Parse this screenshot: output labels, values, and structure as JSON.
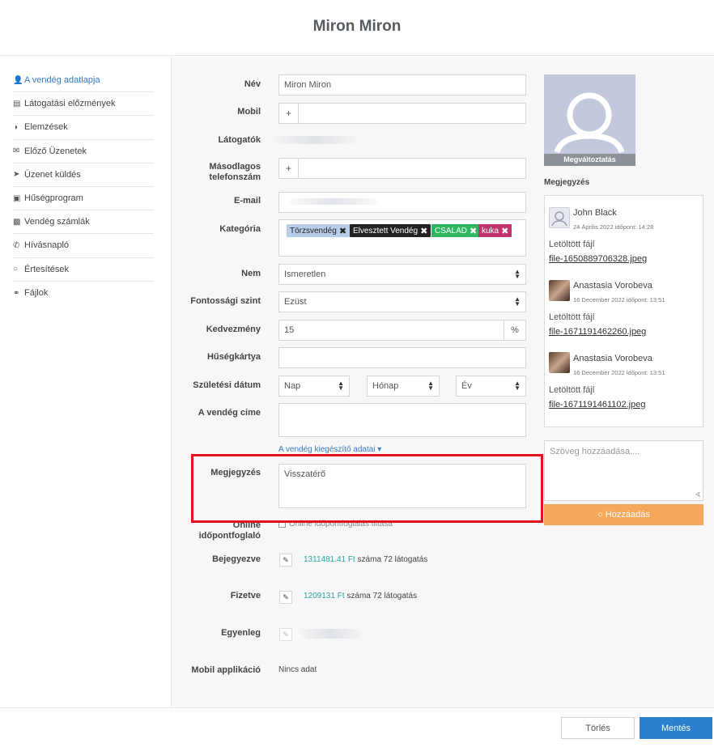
{
  "header": {
    "title": "Miron Miron"
  },
  "sidebar": {
    "items": [
      {
        "label": "A vendég adatlapja",
        "icon": "user-icon"
      },
      {
        "label": "Látogatási előzmények",
        "icon": "list-icon"
      },
      {
        "label": "Elemzések",
        "icon": "pie-chart-icon"
      },
      {
        "label": "Előző Üzenetek",
        "icon": "envelope-icon"
      },
      {
        "label": "Üzenet küldés",
        "icon": "paper-plane-icon"
      },
      {
        "label": "Hűségprogram",
        "icon": "card-icon"
      },
      {
        "label": "Vendég számlák",
        "icon": "briefcase-icon"
      },
      {
        "label": "Hívásnapló",
        "icon": "phone-icon"
      },
      {
        "label": "Értesítések",
        "icon": "comment-icon"
      },
      {
        "label": "Fájlok",
        "icon": "paperclip-icon"
      }
    ]
  },
  "form": {
    "name_label": "Név",
    "name_value": "Miron Miron",
    "mobile_label": "Mobil",
    "mobile_prefix": "+",
    "visitors_label": "Látogatók",
    "secondary_phone_label_1": "Másodlagos",
    "secondary_phone_label_2": "telefonszám",
    "secondary_prefix": "+",
    "email_label": "E-mail",
    "category_label": "Kategória",
    "tags": [
      {
        "label": "Törzsvendég",
        "bg": "#b7cdea",
        "fg": "#222222"
      },
      {
        "label": "Elvesztett Vendég",
        "bg": "#222222",
        "fg": "#ffffff"
      },
      {
        "label": "CSALAD",
        "bg": "#2db560",
        "fg": "#ffffff"
      },
      {
        "label": "kuka",
        "bg": "#c0336e",
        "fg": "#ffffff"
      }
    ],
    "tag_remove": "✖",
    "gender_label": "Nem",
    "gender_value": "Ismeretlen",
    "priority_label": "Fontossági szint",
    "priority_value": "Ezüst",
    "discount_label": "Kedvezmény",
    "discount_value": "15",
    "discount_unit": "%",
    "loyalty_card_label": "Hűségkártya",
    "birth_label": "Születési dátum",
    "birth_day": "Nap",
    "birth_month": "Hónap",
    "birth_year": "Év",
    "address_label": "A vendég cime",
    "extra_link": "A vendég kiegészítő adatai ▾",
    "note_label": "Megjegyzés",
    "note_value": "Visszatérő",
    "online_label_1": "Online",
    "online_label_2": "időpontfoglaló",
    "online_checkbox_text": "Online időpontfoglalás tiltása",
    "booked_label": "Bejegyezve",
    "booked_amount": "1311481.41 Ft",
    "booked_suffix": "száma 72 látogatás",
    "paid_label": "Fizetve",
    "paid_amount": "1209131 Ft",
    "paid_suffix": "száma 72 látogatás",
    "balance_label": "Egyenleg",
    "mobile_app_label": "Mobil applikáció",
    "mobile_app_value": "Nincs adat"
  },
  "right": {
    "avatar_change": "Megváltoztatás",
    "notes_title": "Megjegyzés",
    "notes": [
      {
        "author": "John Black",
        "date": "24 Április 2022 időpont: 14:28",
        "text": "Letöltött fájl",
        "file": "file-1650889706328.jpeg"
      },
      {
        "author": "Anastasia Vorobeva",
        "date": "16 December 2022 időpont: 13:51",
        "text": "Letöltött fájl",
        "file": "file-1671191462260.jpeg"
      },
      {
        "author": "Anastasia Vorobeva",
        "date": "16 December 2022 időpont: 13:51",
        "text": "Letöltött fájl",
        "file": "file-1671191461102.jpeg"
      }
    ],
    "add_placeholder": "Szöveg hozzáadása....",
    "add_button": "Hozzáadás"
  },
  "footer": {
    "delete": "Törlés",
    "save": "Mentés"
  },
  "colors": {
    "accent": "#2a7fd0",
    "add_button": "#f5a85a",
    "highlight": "#e0121c",
    "teal": "#2aa3a8"
  }
}
